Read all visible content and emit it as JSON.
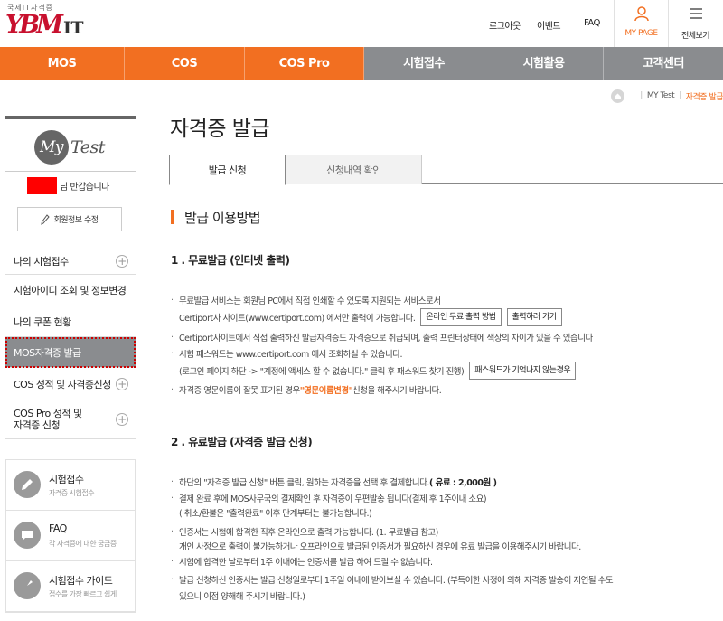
{
  "header": {
    "logo_sub": "국제IT자격증",
    "logo_main": "YBM",
    "logo_it": "IT",
    "util_links": [
      "로그아웃",
      "이벤트",
      "FAQ"
    ],
    "mypage_label": "MY PAGE",
    "viewall_label": "전체보기",
    "accent": "#f26f21"
  },
  "nav": [
    "MOS",
    "COS",
    "COS Pro",
    "시험접수",
    "시험활용",
    "고객센터"
  ],
  "breadcrumb": {
    "item1": "MY Test",
    "current": "자격증 발급"
  },
  "sidebar": {
    "my": "My",
    "test": "Test",
    "welcome": "님 반갑습니다",
    "edit_button": "회원정보 수정",
    "menu": [
      {
        "label": "나의 시험접수"
      },
      {
        "label": "시험아이디 조회 및 정보변경"
      },
      {
        "label": "나의 쿠폰 현황"
      },
      {
        "label": "MOS자격증 발급"
      },
      {
        "label": "COS 성적 및 자격증신청"
      },
      {
        "label": "COS Pro 성적 및",
        "label2": "자격증 신청"
      }
    ],
    "quick": [
      {
        "title": "시험접수",
        "desc": "자격증 시험접수",
        "icon": "pencil-icon"
      },
      {
        "title": "FAQ",
        "desc": "각 자격증에 대한 궁금증",
        "icon": "chat-icon"
      },
      {
        "title": "시험접수 가이드",
        "desc": "접수를 가장 빠르고 쉽게",
        "icon": "compass-icon"
      }
    ]
  },
  "main": {
    "title": "자격증 발급",
    "tabs": [
      "발급 신청",
      "신청내역 확인"
    ],
    "section_title": "발급 이용방법",
    "free": {
      "heading": "1 . 무료발급 (인터넷 출력)",
      "l1": "무료발급 서비스는 회원님 PC에서 직접 인쇄할 수 있도록 지원되는 서비스로서",
      "l1b": "Certiport사 사이트(www.certiport.com) 에서만 출력이 가능합니다.",
      "btn_method": "온라인 무료 출력 방법",
      "btn_print": "출력하러 가기",
      "l2": "Certiport사이트에서 직접 출력하신 발급자격증도 자격증으로 취급되며, 출력 프린터상태에 색상의 차이가 있을 수 있습니다",
      "l3": "시험 패스워드는 www.certiport.com 에서 조회하실 수 있습니다.",
      "l3b": "(로그인 페이지 하단 -> \"계정에 액세스 할 수 없습니다.\" 클릭 후 패스워드 찾기 진행)",
      "btn_pw": "패스워드가 기억나지 않는경우",
      "l4a": "자격증 영문이름이 잘못 표기된 경우 ",
      "l4b": "\"영문이름변경\"",
      "l4c": " 신청을 해주시기 바랍니다."
    },
    "paid": {
      "heading": "2 . 유료발급 (자격증 발급 신청)",
      "l1a": "하단의 \"자격증 발급 신청\" 버튼 클릭, 원하는 자격증을 선택 후 결제합니다. ",
      "l1b": "( 유료 : 2,000원 )",
      "l2": "결제 완료 후에 MOS사무국의 결제확인 후 자격증이 우편발송 됩니다(결제 후 1주이내 소요)",
      "l2b": "( 취소/환불은 \"출력완료\" 이후 단계부터는 불가능합니다.)",
      "l3": "인증서는 시험에 합격한 직후 온라인으로 출력 가능합니다. (1. 무료발급 참고)",
      "l3b": "개인 사정으로 출력이 불가능하거나 오프라인으로 발급된 인증서가 필요하신 경우에 유료 발급을 이용해주시기 바랍니다.",
      "l4": "시험에 합격한 날로부터 1주 이내에는 인증서를 발급 하여 드릴 수 없습니다.",
      "l5": "발급 신청하신 인증서는 발급 신청일로부터 1주일 이내에 받아보실 수 있습니다. (부득이한 사정에 의해 자격증 발송이 지연될 수도",
      "l5b": "있으니 이점 양해해 주시기 바랍니다.)"
    }
  }
}
